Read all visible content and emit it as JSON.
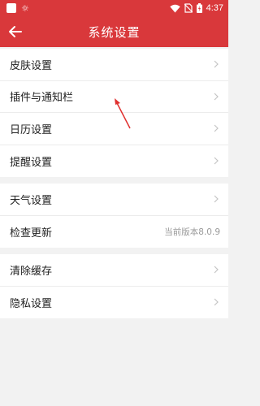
{
  "status_bar": {
    "time": "4:37",
    "icons": [
      "notification-square-icon",
      "sun-icon",
      "wifi-icon",
      "no-sim-icon",
      "battery-charging-icon"
    ]
  },
  "header": {
    "title": "系统设置",
    "back_icon": "back-arrow-icon"
  },
  "groups": [
    {
      "items": [
        {
          "label": "皮肤设置"
        },
        {
          "label": "插件与通知栏"
        },
        {
          "label": "日历设置"
        },
        {
          "label": "提醒设置"
        }
      ]
    },
    {
      "items": [
        {
          "label": "天气设置"
        },
        {
          "label": "检查更新",
          "value": "当前版本8.0.9"
        }
      ]
    },
    {
      "items": [
        {
          "label": "清除缓存"
        },
        {
          "label": "隐私设置"
        }
      ]
    }
  ],
  "colors": {
    "accent": "#d9383b",
    "background": "#f2f2f2",
    "annotation": "#e0302f"
  }
}
